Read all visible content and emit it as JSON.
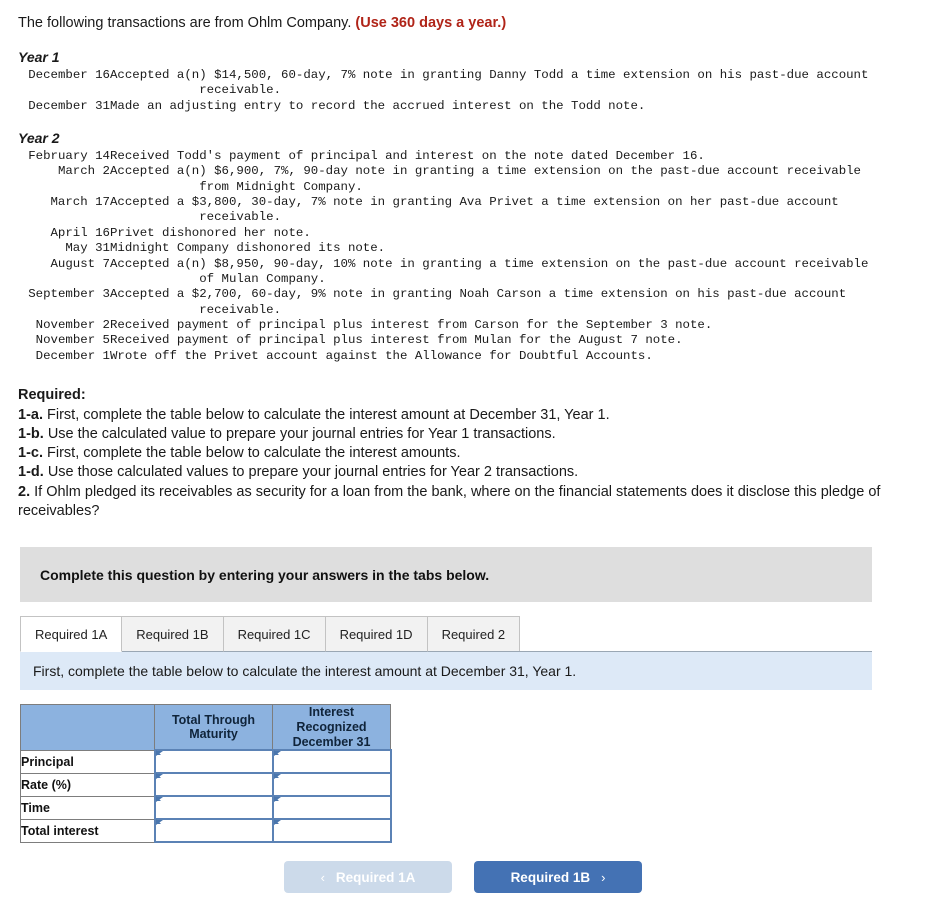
{
  "intro": {
    "text": "The following transactions are from Ohlm Company.",
    "note": "(Use 360 days a year.)"
  },
  "year1": {
    "heading": "Year 1",
    "transactions": [
      {
        "date": "December 16",
        "desc": "Accepted a(n) $14,500, 60-day, 7% note in granting Danny Todd a time extension on his past-due account\n            receivable."
      },
      {
        "date": "December 31",
        "desc": "Made an adjusting entry to record the accrued interest on the Todd note."
      }
    ]
  },
  "year2": {
    "heading": "Year 2",
    "transactions": [
      {
        "date": "February 14",
        "desc": "Received Todd's payment of principal and interest on the note dated December 16."
      },
      {
        "date": "March 2",
        "desc": "Accepted a(n) $6,900, 7%, 90-day note in granting a time extension on the past-due account receivable\n            from Midnight Company."
      },
      {
        "date": "March 17",
        "desc": "Accepted a $3,800, 30-day, 7% note in granting Ava Privet a time extension on her past-due account\n            receivable."
      },
      {
        "date": "April 16",
        "desc": "Privet dishonored her note."
      },
      {
        "date": "May 31",
        "desc": "Midnight Company dishonored its note."
      },
      {
        "date": "August 7",
        "desc": "Accepted a(n) $8,950, 90-day, 10% note in granting a time extension on the past-due account receivable\n            of Mulan Company."
      },
      {
        "date": "September 3",
        "desc": "Accepted a $2,700, 60-day, 9% note in granting Noah Carson a time extension on his past-due account\n            receivable."
      },
      {
        "date": "November 2",
        "desc": "Received payment of principal plus interest from Carson for the September 3 note."
      },
      {
        "date": "November 5",
        "desc": "Received payment of principal plus interest from Mulan for the August 7 note."
      },
      {
        "date": "December 1",
        "desc": "Wrote off the Privet account against the Allowance for Doubtful Accounts."
      }
    ]
  },
  "required": {
    "title": "Required:",
    "items": [
      {
        "label": "1-a.",
        "text": "First, complete the table below to calculate the interest amount at December 31, Year 1."
      },
      {
        "label": "1-b.",
        "text": "Use the calculated value to prepare your journal entries for Year 1 transactions."
      },
      {
        "label": "1-c.",
        "text": "First, complete the table below to calculate the interest amounts."
      },
      {
        "label": "1-d.",
        "text": "Use those calculated values to prepare your journal entries for Year 2 transactions."
      },
      {
        "label": "2.",
        "text": "If Ohlm pledged its receivables as security for a loan from the bank, where on the financial statements does it disclose this pledge of receivables?"
      }
    ]
  },
  "banner": {
    "text": "Complete this question by entering your answers in the tabs below."
  },
  "tabs": {
    "items": [
      {
        "label": "Required 1A",
        "active": true
      },
      {
        "label": "Required 1B",
        "active": false
      },
      {
        "label": "Required 1C",
        "active": false
      },
      {
        "label": "Required 1D",
        "active": false
      },
      {
        "label": "Required 2",
        "active": false
      }
    ]
  },
  "instruction": {
    "text": "First, complete the table below to calculate the interest amount at December 31, Year 1."
  },
  "answer_table": {
    "corner_header": "",
    "column_headers": [
      "Total Through Maturity",
      "Interest Recognized December 31"
    ],
    "rows": [
      {
        "label": "Principal",
        "values": [
          "",
          ""
        ]
      },
      {
        "label": "Rate (%)",
        "values": [
          "",
          ""
        ]
      },
      {
        "label": "Time",
        "values": [
          "",
          ""
        ]
      },
      {
        "label": "Total interest",
        "values": [
          "",
          ""
        ]
      }
    ]
  },
  "nav": {
    "prev_label": "Required 1A",
    "prev_chevron": "‹",
    "next_label": "Required 1B",
    "next_chevron": "›"
  },
  "colors": {
    "accent_red": "#b02418",
    "table_header_blue": "#8cb2df",
    "instruction_blue": "#dde9f7",
    "banner_gray": "#dedede",
    "next_button_blue": "#4472b4",
    "prev_button_blue": "#ccdaea",
    "input_border_blue": "#5b82b5"
  }
}
